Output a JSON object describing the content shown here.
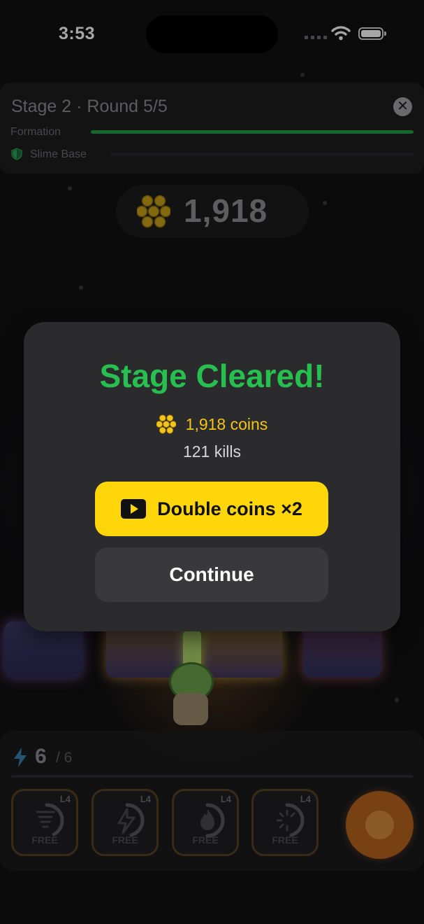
{
  "status_bar": {
    "time": "3:53"
  },
  "stage": {
    "title": "Stage 2 · Round 5/5",
    "close_glyph": "✕",
    "formation_label": "Formation",
    "base_label": "Slime Base"
  },
  "coins_hud": {
    "total": "1,918",
    "icon": "coin-cluster-icon"
  },
  "dialog": {
    "title": "Stage Cleared!",
    "coins_text": "1,918 coins",
    "kills_text": "121 kills",
    "double_label": "Double coins ×2",
    "continue_label": "Continue"
  },
  "energy": {
    "current": "6",
    "max": "/ 6"
  },
  "skills": [
    {
      "level": "L4",
      "badge": "FREE",
      "icon": "tornado-icon"
    },
    {
      "level": "L4",
      "badge": "FREE",
      "icon": "lightning-icon"
    },
    {
      "level": "L4",
      "badge": "FREE",
      "icon": "flame-icon"
    },
    {
      "level": "L4",
      "badge": "FREE",
      "icon": "spinner-icon"
    }
  ],
  "colors": {
    "accent_green": "#27c04f",
    "coin_yellow": "#f3c51b",
    "button_yellow": "#ffd60a",
    "fire_orange": "#b8651f"
  }
}
